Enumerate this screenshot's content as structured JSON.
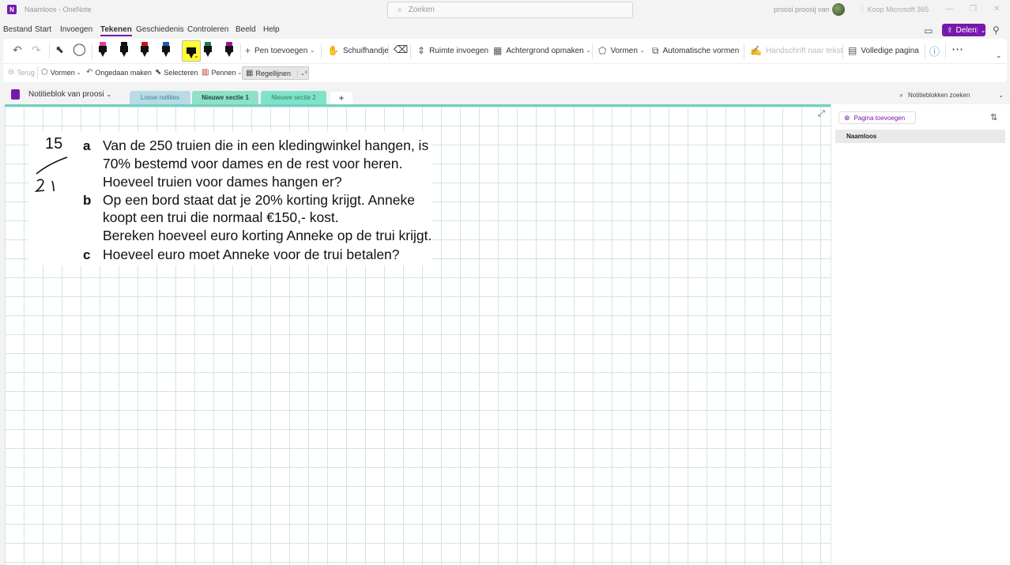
{
  "titlebar": {
    "app_icon": "N",
    "title": "Naamloos  -  OneNote",
    "search_placeholder": "Zoeken",
    "user_name": "proosi proosij van",
    "buy_label": "Koop Microsoft 365",
    "minimize": "—",
    "restore": "❐",
    "close": "✕"
  },
  "menu": {
    "items": [
      "Bestand",
      "Start",
      "Invoegen",
      "Tekenen",
      "Geschiedenis",
      "Controleren",
      "Beeld",
      "Help"
    ],
    "active": "Tekenen",
    "share_label": "Delen"
  },
  "ribbon": {
    "add_pen": "Pen toevoegen",
    "pan": "Schuifhandje",
    "insert_space": "Ruimte invoegen",
    "background_format": "Achtergrond opmaken",
    "shapes": "Vormen",
    "auto_shapes": "Automatische vormen",
    "ink_to_text": "Handschrift naar tekst",
    "full_page": "Volledige pagina",
    "pens": [
      {
        "cap": "#e040a0",
        "selected": false
      },
      {
        "cap": "#111111",
        "selected": false
      },
      {
        "cap": "#d01020",
        "selected": false
      },
      {
        "cap": "#1060c0",
        "selected": false
      },
      {
        "cap": "#ffff32",
        "selected": true
      },
      {
        "cap": "#108040",
        "selected": false
      },
      {
        "cap": "#a010a0",
        "selected": false
      }
    ]
  },
  "subribbon": {
    "back": "Terug",
    "shapes": "Vormen",
    "undo": "Ongedaan maken",
    "select": "Selecteren",
    "pens": "Pennen",
    "rule_lines": "Regellijnen"
  },
  "notebook": {
    "name": "Notitieblok van proosi",
    "tabs": [
      {
        "label": "Losse notities",
        "color": "#b8dbe8",
        "text_color": "#4a7a8a",
        "active": false
      },
      {
        "label": "Nieuwe sectie 1",
        "color": "#8fe0c8",
        "text_color": "#1e4a3c",
        "active": true
      },
      {
        "label": "Nieuwe sectie 2",
        "color": "#7fe3c9",
        "text_color": "#3a7a66",
        "active": false
      }
    ],
    "add_tab": "+",
    "search_placeholder": "Notitieblokken zoeken"
  },
  "page": {
    "exercise_number": "15",
    "questions": [
      {
        "letter": "a",
        "lines": [
          "Van de 250 truien die in een kledingwinkel hangen, is",
          "70% bestemd voor dames en de rest voor heren.",
          "Hoeveel truien voor dames hangen er?"
        ]
      },
      {
        "letter": "b",
        "lines": [
          "Op een bord staat dat je 20% korting krijgt. Anneke",
          "koopt een trui die normaal €150,- kost.",
          "Bereken hoeveel euro korting Anneke op de trui krijgt."
        ]
      },
      {
        "letter": "c",
        "lines": [
          "Hoeveel euro moet Anneke voor de trui betalen?"
        ]
      }
    ]
  },
  "sidebar": {
    "add_page": "Pagina toevoegen",
    "pages": [
      "Naamloos"
    ]
  }
}
